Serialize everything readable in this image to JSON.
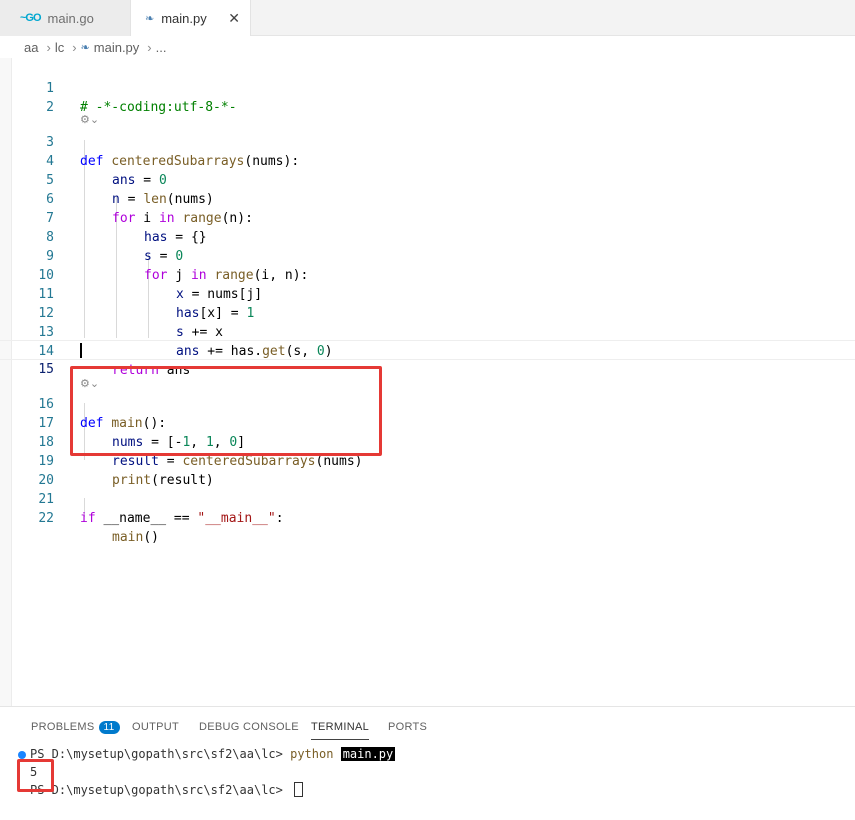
{
  "tabs": [
    {
      "icon": "~GO",
      "label": "main.go"
    },
    {
      "icon": "❧",
      "label": "main.py",
      "close": "✕"
    }
  ],
  "breadcrumb": [
    "aa",
    "lc",
    "main.py",
    "..."
  ],
  "editor": {
    "lens_icon": "⚙⌄",
    "lines": {
      "l1": {
        "n": "1",
        "comment": "# -*-coding:utf-8-*-"
      },
      "l2": {
        "n": "2"
      },
      "l3": {
        "n": "3",
        "kw": "def",
        "fn": "centeredSubarrays",
        "rest": "(nums):"
      },
      "l4": {
        "n": "4",
        "a": "ans",
        "b": " = ",
        "c": "0"
      },
      "l5": {
        "n": "5",
        "a": "n",
        "b": " = ",
        "c": "len",
        "d": "(nums)"
      },
      "l6": {
        "n": "6",
        "a": "for",
        "b": " i ",
        "c": "in",
        "d": " ",
        "e": "range",
        "f": "(n):"
      },
      "l7": {
        "n": "7",
        "a": "has",
        "b": " = {}"
      },
      "l8": {
        "n": "8",
        "a": "s",
        "b": " = ",
        "c": "0"
      },
      "l9": {
        "n": "9",
        "a": "for",
        "b": " j ",
        "c": "in",
        "d": " ",
        "e": "range",
        "f": "(i, n):"
      },
      "l10": {
        "n": "10",
        "a": "x",
        "b": " = nums[j]"
      },
      "l11": {
        "n": "11",
        "a": "has",
        "b": "[x] = ",
        "c": "1"
      },
      "l12": {
        "n": "12",
        "a": "s",
        "b": " += x"
      },
      "l13": {
        "n": "13",
        "a": "ans",
        "b": " += has.",
        "c": "get",
        "d": "(s, ",
        "e": "0",
        "f": ")"
      },
      "l14": {
        "n": "14",
        "a": "return",
        "b": " ans"
      },
      "l15": {
        "n": "15"
      },
      "l16": {
        "n": "16",
        "kw": "def",
        "fn": "main",
        "rest": "():"
      },
      "l17": {
        "n": "17",
        "a": "nums",
        "b": " = [-",
        "c": "1",
        "d": ", ",
        "e": "1",
        "f": ", ",
        "g": "0",
        "h": "]"
      },
      "l18": {
        "n": "18",
        "a": "result",
        "b": " = ",
        "c": "centeredSubarrays",
        "d": "(nums)"
      },
      "l19": {
        "n": "19",
        "a": "print",
        "b": "(result)"
      },
      "l20": {
        "n": "20"
      },
      "l21": {
        "n": "21",
        "a": "if",
        "b": " __name__ == ",
        "c": "\"__main__\"",
        "d": ":"
      },
      "l22": {
        "n": "22",
        "a": "main",
        "b": "()"
      }
    }
  },
  "panel": {
    "tabs": [
      "PROBLEMS",
      "OUTPUT",
      "DEBUG CONSOLE",
      "TERMINAL",
      "PORTS"
    ],
    "problems_count": "11",
    "terminal": {
      "prompt1": "PS D:\\mysetup\\gopath\\src\\sf2\\aa\\lc> ",
      "cmd": "python",
      "arg": "main.py",
      "output": "5",
      "prompt2": "PS D:\\mysetup\\gopath\\src\\sf2\\aa\\lc> "
    }
  },
  "colors": {
    "highlight_box": "#e53935",
    "badge": "#007acc"
  }
}
